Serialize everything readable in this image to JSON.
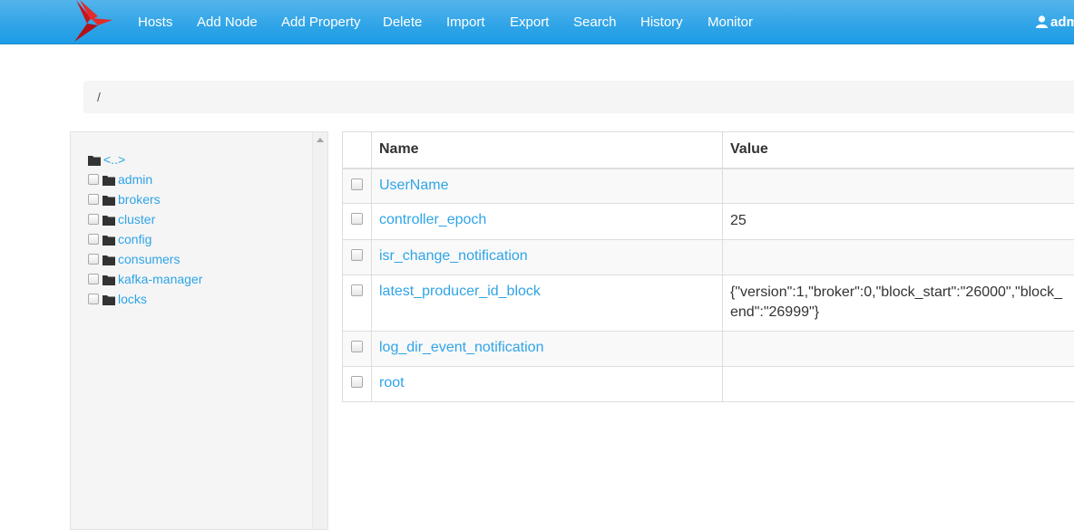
{
  "nav": {
    "items": [
      "Hosts",
      "Add Node",
      "Add Property",
      "Delete",
      "Import",
      "Export",
      "Search",
      "History",
      "Monitor"
    ],
    "user": "adm"
  },
  "breadcrumb": {
    "path": "/"
  },
  "tree": {
    "parent_label": "<..>",
    "items": [
      "admin",
      "brokers",
      "cluster",
      "config",
      "consumers",
      "kafka-manager",
      "locks"
    ]
  },
  "table": {
    "headers": {
      "name": "Name",
      "value": "Value"
    },
    "rows": [
      {
        "name": "UserName",
        "value": ""
      },
      {
        "name": "controller_epoch",
        "value": "25"
      },
      {
        "name": "isr_change_notification",
        "value": ""
      },
      {
        "name": "latest_producer_id_block",
        "value": "{\"version\":1,\"broker\":0,\"block_start\":\"26000\",\"block_\nend\":\"26999\"}"
      },
      {
        "name": "log_dir_event_notification",
        "value": ""
      },
      {
        "name": "root",
        "value": ""
      }
    ]
  },
  "colors": {
    "navbar": "#2fa4e7",
    "link": "#2fa4e7",
    "logo": "#e32b2b"
  }
}
